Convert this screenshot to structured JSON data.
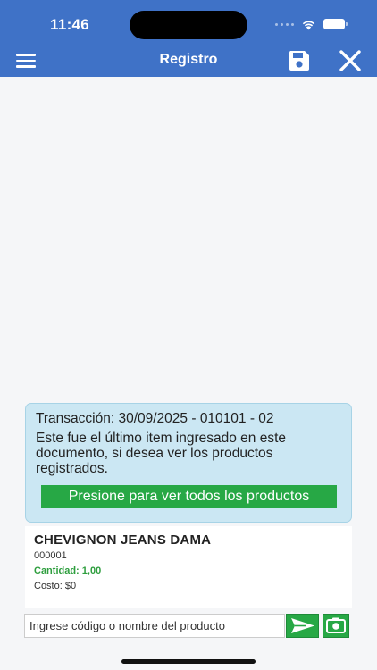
{
  "status_bar": {
    "time": "11:46"
  },
  "header": {
    "title": "Registro",
    "menu_icon": "hamburger-menu-icon",
    "save_icon": "floppy-disk-icon",
    "close_icon": "close-icon",
    "background_color": "#3f72c7"
  },
  "info_box": {
    "transaction": "Transacción: 30/09/2025 - 010101 - 02",
    "message": "Este fue el último item ingresado en este documento, si desea ver los productos registrados.",
    "button_label": "Presione para ver todos los productos",
    "background_color": "#cbe7f3"
  },
  "product": {
    "name": "CHEVIGNON JEANS DAMA",
    "code": "000001",
    "quantity": "Cantidad: 1,00",
    "cost": "Costo: $0"
  },
  "search": {
    "placeholder": "Ingrese código o nombre del producto",
    "send_icon": "send-arrow-icon",
    "camera_icon": "camera-icon"
  },
  "colors": {
    "accent_green": "#27a845",
    "quantity_green": "#2e9e3e"
  }
}
